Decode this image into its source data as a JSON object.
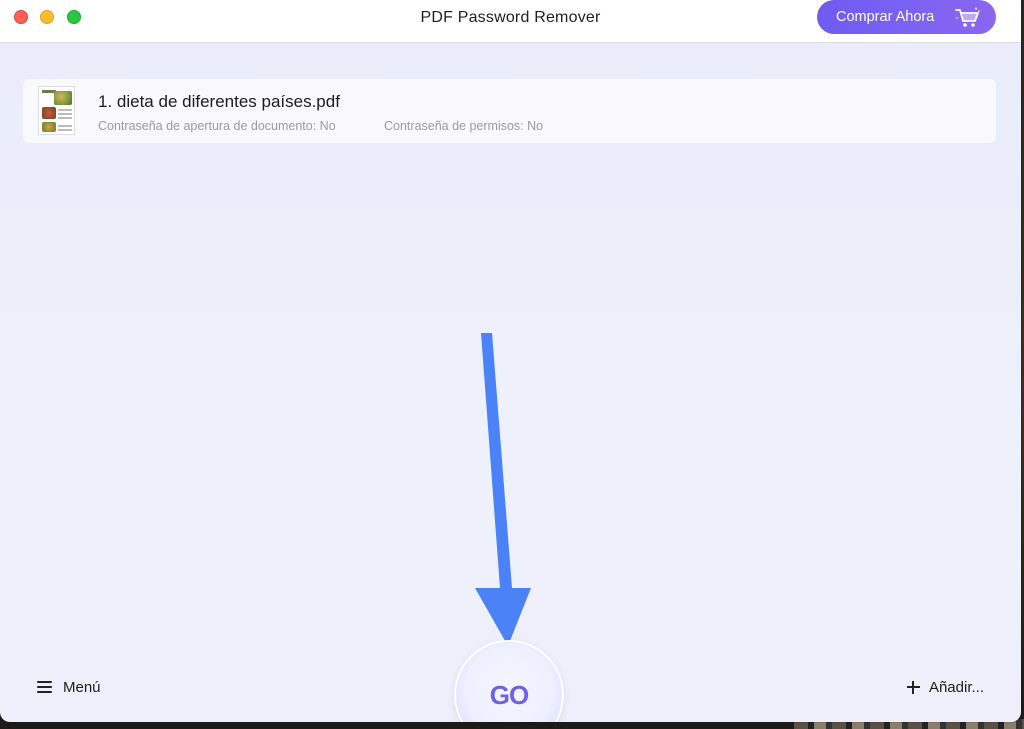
{
  "window": {
    "title": "PDF Password Remover"
  },
  "header": {
    "buy_label": "Comprar Ahora",
    "buy_icon": "cart-icon",
    "buy_color": "#7a62f2"
  },
  "files": [
    {
      "name": "1. dieta de diferentes países.pdf",
      "open_password": "Contraseña de apertura de documento: No",
      "permissions_password": "Contraseña de permisos: No"
    }
  ],
  "footer": {
    "menu_label": "Menú",
    "go_label": "GO",
    "add_label": "Añadir...",
    "accent_color": "#6d61e6"
  },
  "annotation": {
    "arrow_color": "#4b82f7",
    "arrow_icon": "down-arrow"
  }
}
